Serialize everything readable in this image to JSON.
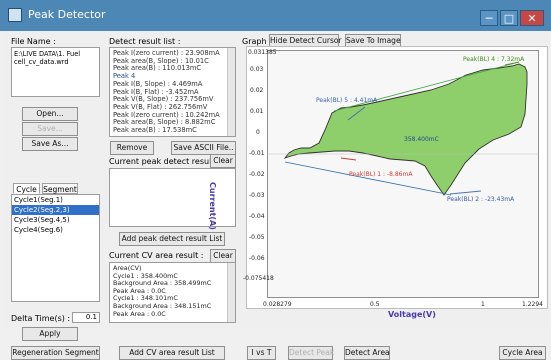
{
  "window": {
    "title": "Peak Detector",
    "controls": {
      "minimize": "─",
      "maximize": "□",
      "close": "✕"
    }
  },
  "file": {
    "label": "File Name :",
    "value": "E:\\LIVE DATA\\1. Fuel cell_cv_data.wrd"
  },
  "file_buttons": {
    "open": "Open...",
    "save": "Save...",
    "save_as": "Save As..."
  },
  "tabs": [
    "Cycle",
    "Segment"
  ],
  "cycles": [
    "Cycle1(Seg.1)",
    "Cycle2(Seg.2,3)",
    "Cycle3(Seg.4,5)",
    "Cycle4(Seg.6)"
  ],
  "delta": {
    "label": "Delta Time(s) :",
    "value": "0.1"
  },
  "apply": "Apply",
  "regeneration": "Regeneration Segment",
  "detect_list": {
    "label": "Detect result list :",
    "lines": [
      "Peak I(zero current) : 23.908mA",
      "Peak area(B, Slope) : 10.01C",
      "Peak area(B) : 110.013mC",
      "Peak 4",
      "Peak I(B, Slope) : 4.469mA",
      "Peak I(B, Flat) : -3.452mA",
      "Peak V(B, Slope) : 237.756mV",
      "Peak V(B, Flat) : 262.756mV",
      "Peak I(zero current) : 10.242mA",
      "Peak area(B, Slope) : 8.882mC",
      "Peak area(B) : 17.538mC"
    ],
    "remove": "Remove",
    "save_ascii": "Save ASCII File.."
  },
  "current_peak": {
    "label": "Current peak detect result :",
    "clear": "Clear",
    "add": "Add peak detect result List"
  },
  "current_cv": {
    "label": "Current CV area result :",
    "clear": "Clear",
    "lines": [
      "Area(CV)",
      "Cycle1 : 358.400mC",
      "Background Area : 358.499mC",
      "Peak Area : 0.0C",
      "Cycle1 : 348.101mC",
      "Background Area : 348.151mC",
      "Peak Area : 0.0C"
    ],
    "add": "Add CV area result List"
  },
  "graph": {
    "label": "Graph :",
    "hide_cursor": "Hide Detect Cursor",
    "save_image": "Save To Image",
    "xlabel": "Voltage(V)",
    "ylabel": "Current(A)",
    "yticks": [
      "0.031385",
      "0.03",
      "0.02",
      "0.01",
      "0",
      "-0.01",
      "-0.02",
      "-0.03",
      "-0.04",
      "-0.05",
      "-0.06",
      "-0.075418"
    ],
    "xticks": [
      "0.028279",
      "0.5",
      "1",
      "1.2294"
    ],
    "annotations": [
      "Peak(BL) 4 : 7.32mA",
      "Peak(BL) 5 : 4.41mA",
      "358.400mC",
      "Peak(BL) 1 : -8.86mA",
      "Peak(BL) 2 : -23.43mA"
    ]
  },
  "bottom_buttons": {
    "ivst": "I vs T",
    "detect_peak": "Detect Peak",
    "detect_area": "Detect Area",
    "cycle_area": "Cycle Area"
  },
  "colors": {
    "titlebar": "#4d87b6",
    "fill": "#8fcf6b",
    "outline": "#2b2b2b"
  }
}
